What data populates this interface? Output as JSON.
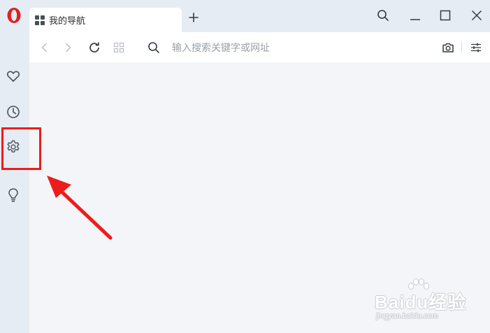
{
  "tab": {
    "title": "我的导航"
  },
  "address_bar": {
    "placeholder": "输入搜索关键字或网址",
    "value": ""
  },
  "sidebar": {
    "items": [
      {
        "icon": "heart-icon"
      },
      {
        "icon": "clock-icon"
      },
      {
        "icon": "gear-icon"
      },
      {
        "icon": "lightbulb-icon"
      }
    ]
  },
  "colors": {
    "brand_red": "#e1201e",
    "annotation_red": "#ee1c1c",
    "chrome_bg": "#e6ecf4",
    "content_bg": "#f4f5f8"
  },
  "watermark": {
    "brand": "Baidu经验",
    "url": "jingyan.baidu.com"
  }
}
